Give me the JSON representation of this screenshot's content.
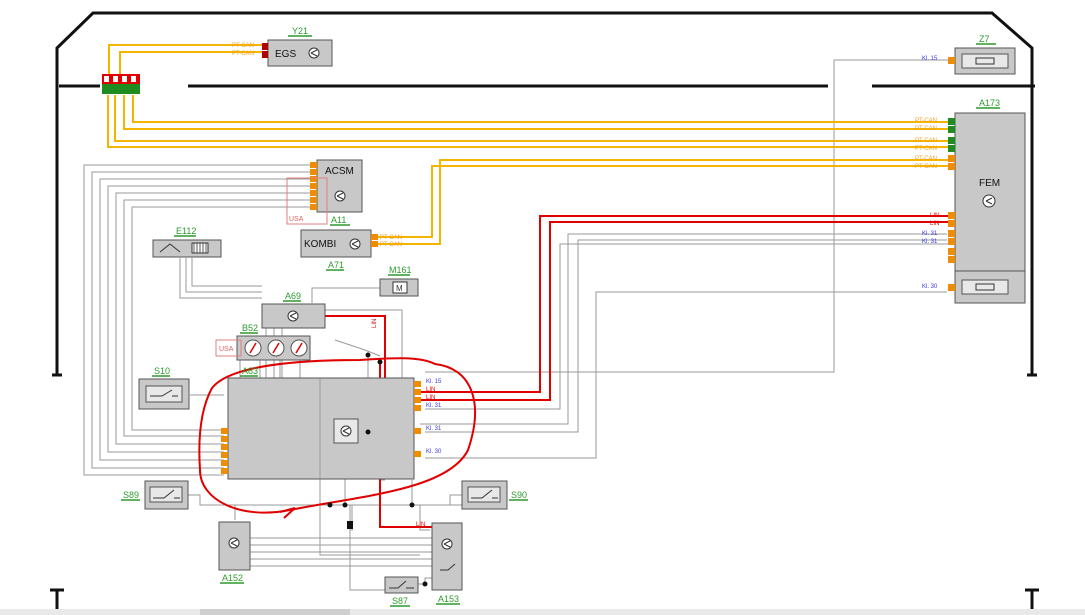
{
  "components": {
    "Y21": {
      "id": "Y21",
      "name": "EGS",
      "pins": [
        "PT-CAN",
        "PT-CAN"
      ]
    },
    "Z7": {
      "id": "Z7",
      "pins": [
        "Kl. 15"
      ]
    },
    "A173": {
      "id": "A173",
      "name": "FEM",
      "pins": [
        "PT-CAN",
        "PT-CAN",
        "PT-CAN",
        "PT-CAN",
        "PT-CAN",
        "PT-CAN",
        "LIN",
        "LIN",
        "Kl. 31",
        "Kl. 31",
        "Kl. 30"
      ]
    },
    "A11": {
      "id": "A11",
      "name": "ACSM",
      "tag": "USA"
    },
    "A71": {
      "id": "A71",
      "name": "KOMBI",
      "pins": [
        "PT-CAN",
        "PT-CAN"
      ]
    },
    "E112": {
      "id": "E112"
    },
    "M161": {
      "id": "M161"
    },
    "A69": {
      "id": "A69",
      "wire": "LIN"
    },
    "B52": {
      "id": "B52",
      "tag": "USA"
    },
    "S10": {
      "id": "S10"
    },
    "A83": {
      "id": "A83",
      "pins": [
        "Kl. 15",
        "LIN",
        "LIN",
        "Kl. 31",
        "Kl. 31",
        "Kl. 30"
      ]
    },
    "S89": {
      "id": "S89"
    },
    "S90": {
      "id": "S90"
    },
    "A152": {
      "id": "A152"
    },
    "A153": {
      "id": "A153",
      "wire": "LIN"
    },
    "S87": {
      "id": "S87"
    }
  },
  "colors": {
    "can_wire": "#f5b400",
    "lin_wire": "#e00000",
    "ground_wire": "#9a9a9a",
    "module_fill": "#c8c8c8",
    "pin_orange": "#f08c00",
    "pin_green": "#1e8c1e",
    "id_label": "#2d9a2d",
    "kl_label": "#3a3ae0",
    "can_label": "#f0a020",
    "annotation": "#e00000"
  },
  "icons": [
    "transistor-symbol-icon",
    "motor-icon",
    "switch-icon",
    "gauge-icon",
    "fuse-icon"
  ]
}
